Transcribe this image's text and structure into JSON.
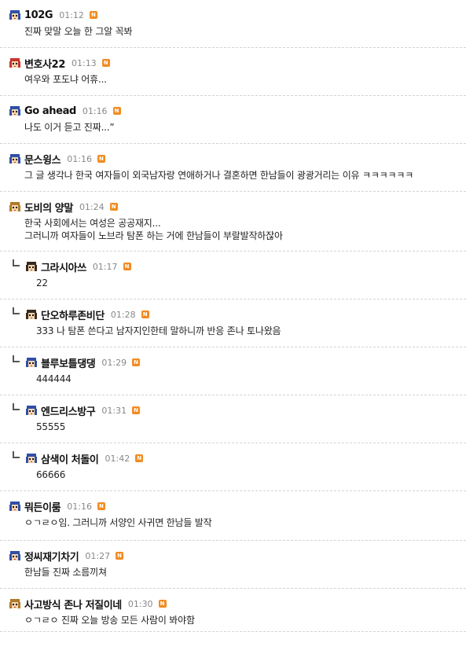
{
  "comments": [
    {
      "nick": "102G",
      "time": "01:12",
      "body": "진짜 맞말 오늘 한 그알 꼭봐",
      "reply": false,
      "avatar": "blue-hair"
    },
    {
      "nick": "변호사22",
      "time": "01:13",
      "body": "여우와 포도냐 어휴...",
      "reply": false,
      "avatar": "red-hair"
    },
    {
      "nick": "Go ahead",
      "time": "01:16",
      "body": "나도 이거 듣고 진짜...”",
      "reply": false,
      "avatar": "blue-hair"
    },
    {
      "nick": "문스윙스",
      "time": "01:16",
      "body": "그 글 생각나 한국 여자들이 외국남자랑 연애하거나 결혼하면 한남들이 광광거리는 이유 ㅋㅋㅋㅋㅋㅋ",
      "reply": false,
      "avatar": "blue-hair"
    },
    {
      "nick": "도비의 양말",
      "time": "01:24",
      "body": "한국 사회에서는 여성은 공공재지...\n그러니까 여자들이 노브라 탐폰 하는 거에 한남들이 부랄발작하잖아",
      "reply": false,
      "avatar": "brown-hair"
    },
    {
      "nick": "그라시아쓰",
      "time": "01:17",
      "body": "22",
      "reply": true,
      "avatar": "dark-hair"
    },
    {
      "nick": "단오하루존비단",
      "time": "01:28",
      "body": "333 나 탐폰 쓴다고 남자지인한테 말하니까 반응 존나 토나왔음",
      "reply": true,
      "avatar": "dark-hair"
    },
    {
      "nick": "블루보틀댕댕",
      "time": "01:29",
      "body": "444444",
      "reply": true,
      "avatar": "blue-hair"
    },
    {
      "nick": "엔드리스방구",
      "time": "01:31",
      "body": "55555",
      "reply": true,
      "avatar": "blue-hair"
    },
    {
      "nick": "삼색이 처돌이",
      "time": "01:42",
      "body": "66666",
      "reply": true,
      "avatar": "blue-hair"
    },
    {
      "nick": "뭐든이룸",
      "time": "01:16",
      "body": "ㅇㄱㄹㅇ임. 그러니까 서양인 사귀면 한남들 발작",
      "reply": false,
      "avatar": "blue-hair"
    },
    {
      "nick": "정씨재기차기",
      "time": "01:27",
      "body": "한남들 진짜 소름끼쳐",
      "reply": false,
      "avatar": "blue-hair"
    },
    {
      "nick": "사고방식 존나 저질이네",
      "time": "01:30",
      "body": "ㅇㄱㄹㅇ 진짜 오늘 방송 모든 사람이 봐야함",
      "reply": false,
      "avatar": "brown-hair"
    }
  ],
  "new_badge_label": "N",
  "colors": {
    "blue-hair": "#2f4fa8",
    "red-hair": "#c8322a",
    "brown-hair": "#b07a2a",
    "dark-hair": "#3a2a20",
    "skin": "#f6d6b0",
    "badge": "#f28b20"
  }
}
